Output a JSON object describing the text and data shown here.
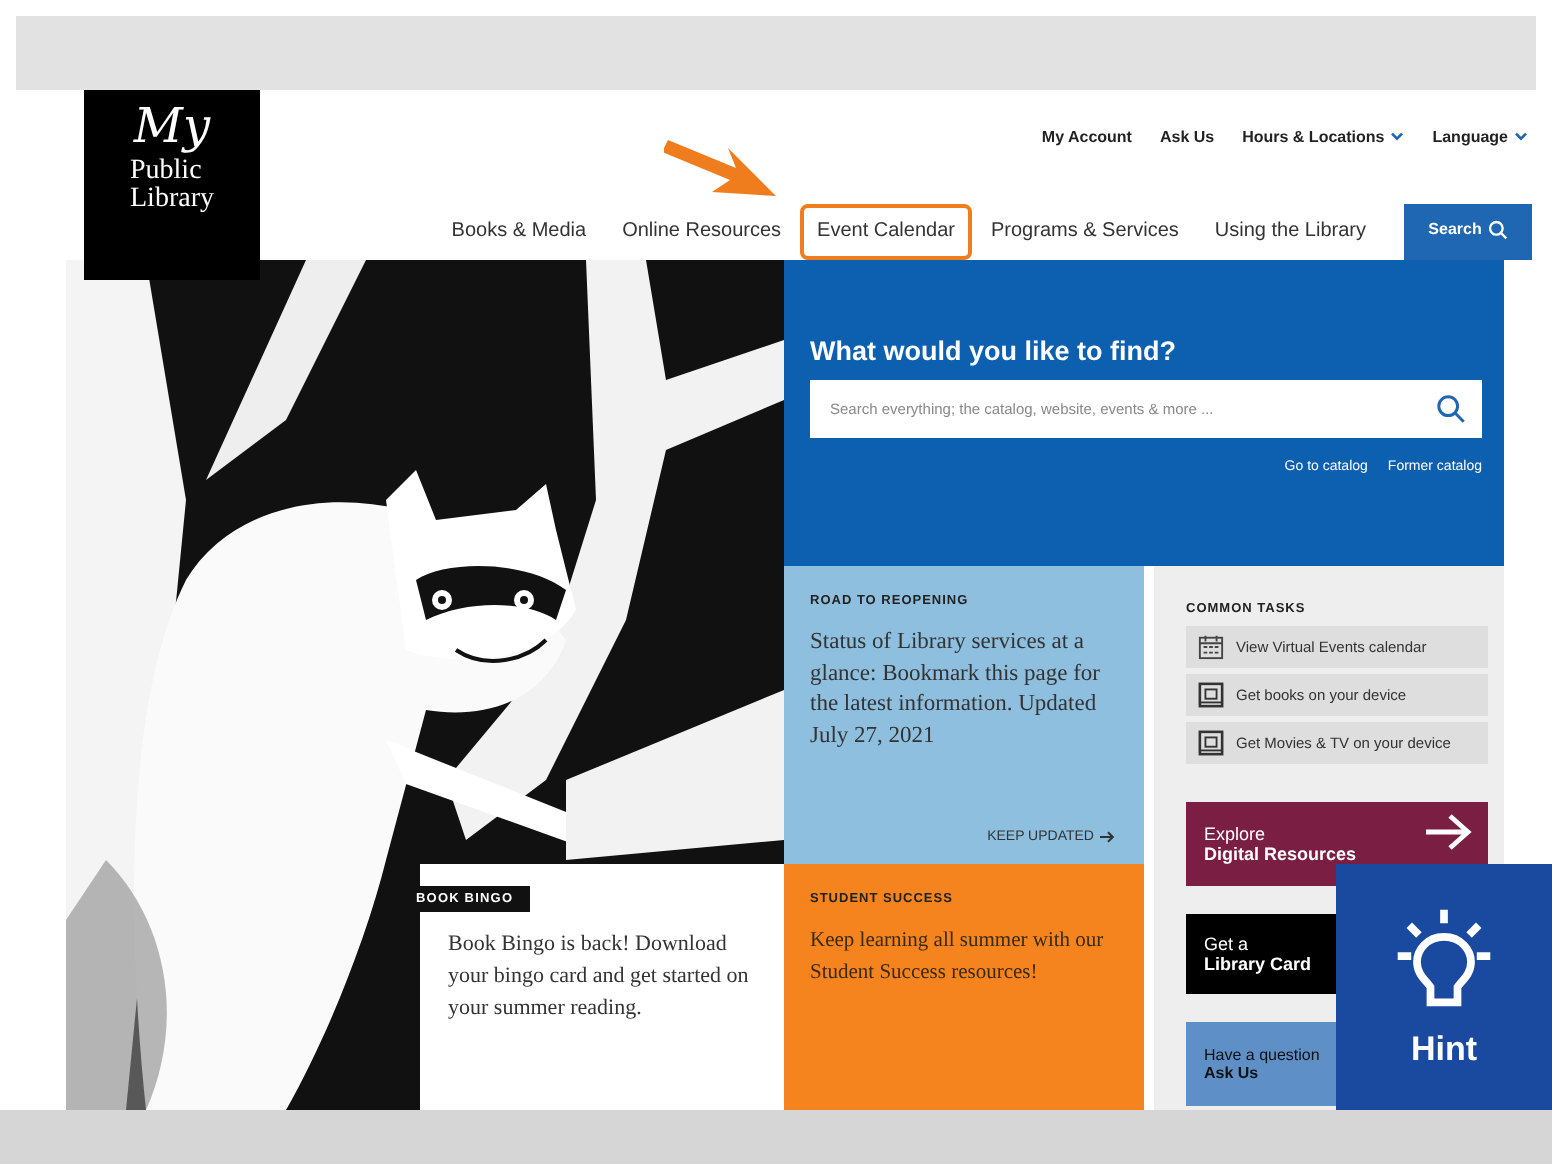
{
  "logo": {
    "script": "My",
    "name_lines": [
      "Public",
      "Library"
    ]
  },
  "utility_links": [
    {
      "label": "My Account",
      "dropdown": false
    },
    {
      "label": "Ask Us",
      "dropdown": false
    },
    {
      "label": "Hours & Locations",
      "dropdown": true
    },
    {
      "label": "Language",
      "dropdown": true
    }
  ],
  "nav": [
    {
      "label": "Books & Media",
      "highlighted": false
    },
    {
      "label": "Online Resources",
      "highlighted": false
    },
    {
      "label": "Event Calendar",
      "highlighted": true
    },
    {
      "label": "Programs & Services",
      "highlighted": false
    },
    {
      "label": "Using the Library",
      "highlighted": false
    }
  ],
  "search_button": {
    "label": "Search"
  },
  "search_panel": {
    "heading": "What would you like to find?",
    "placeholder": "Search everything; the catalog, website, events & more ...",
    "links": [
      "Go to catalog",
      "Former catalog"
    ]
  },
  "book_bingo": {
    "tag": "BOOK BINGO",
    "text": "Book Bingo is back! Download your bingo card and get started on your summer reading."
  },
  "reopening": {
    "tag": "ROAD TO REOPENING",
    "text": "Status of Library services at a glance: Bookmark this page for the latest information. Updated July 27, 2021",
    "link": "KEEP UPDATED"
  },
  "student_success": {
    "tag": "STUDENT SUCCESS",
    "text": "Keep learning all summer with our Student Success resources!"
  },
  "common_tasks": {
    "heading": "COMMON TASKS",
    "items": [
      {
        "kind": "calendar",
        "label": "View Virtual Events calendar"
      },
      {
        "kind": "device",
        "label": "Get books on your device"
      },
      {
        "kind": "device",
        "label": "Get Movies & TV on your device"
      }
    ]
  },
  "promos": [
    {
      "kind": "explore",
      "line1": "Explore",
      "line2": "Digital Resources"
    },
    {
      "kind": "card",
      "line1": "Get a",
      "line2": "Library Card"
    },
    {
      "kind": "question",
      "line1": "Have a question",
      "line2": "Ask Us"
    }
  ],
  "hint": {
    "label": "Hint"
  }
}
